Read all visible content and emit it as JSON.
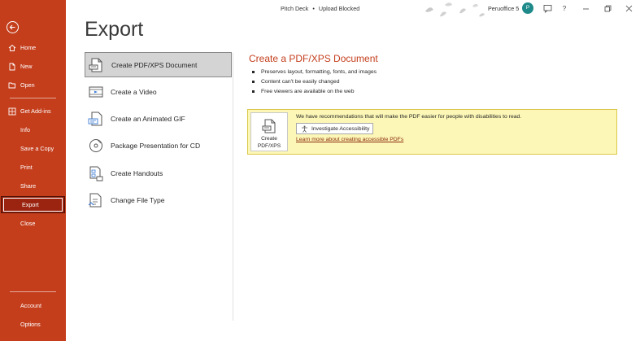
{
  "window": {
    "doc_title": "Pitch Deck",
    "separator": "•",
    "status": "Upload Blocked",
    "user_name": "Peruoffice 5",
    "avatar_initial": "P",
    "help_label": "?"
  },
  "sidebar": {
    "items": [
      {
        "label": "Home",
        "icon": "home-icon"
      },
      {
        "label": "New",
        "icon": "new-document-icon"
      },
      {
        "label": "Open",
        "icon": "folder-open-icon"
      },
      {
        "label": "Get Add-ins",
        "icon": "add-ins-grid-icon"
      },
      {
        "label": "Info"
      },
      {
        "label": "Save a Copy"
      },
      {
        "label": "Print"
      },
      {
        "label": "Share"
      },
      {
        "label": "Export",
        "active": true
      },
      {
        "label": "Close"
      }
    ],
    "bottom_items": [
      {
        "label": "Account"
      },
      {
        "label": "Options"
      }
    ]
  },
  "main": {
    "title": "Export",
    "options": [
      {
        "label": "Create PDF/XPS Document",
        "icon": "pdf-document-icon",
        "selected": true
      },
      {
        "label": "Create a Video",
        "icon": "video-icon"
      },
      {
        "label": "Create an Animated GIF",
        "icon": "gif-icon"
      },
      {
        "label": "Package Presentation for CD",
        "icon": "cd-package-icon"
      },
      {
        "label": "Create Handouts",
        "icon": "handouts-icon"
      },
      {
        "label": "Change File Type",
        "icon": "change-file-type-icon"
      }
    ]
  },
  "detail": {
    "title": "Create a PDF/XPS Document",
    "bullets": [
      "Preserves layout, formatting, fonts, and images",
      "Content can't be easily changed",
      "Free viewers are available on the web"
    ],
    "create_button_line1": "Create",
    "create_button_line2": "PDF/XPS",
    "recommendation": "We have recommendations that will make the PDF easier for people with disabilities to read.",
    "accessibility_button": "Investigate Accessibility",
    "learn_more_link": "Learn more about creating accessible PDFs"
  },
  "colors": {
    "sidebar_bg": "#c43e1c",
    "sidebar_active": "#9a2410",
    "accent_text": "#c43e1c",
    "recommendation_bg": "#fcf7b6",
    "avatar_bg": "#1f8a8a"
  }
}
